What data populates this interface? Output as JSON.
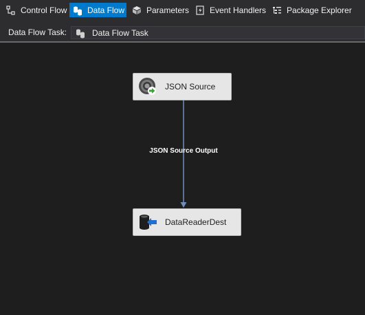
{
  "tabs": [
    {
      "label": "Control Flow",
      "icon": "control-flow-icon",
      "active": false
    },
    {
      "label": "Data Flow",
      "icon": "data-flow-icon",
      "active": true
    },
    {
      "label": "Parameters",
      "icon": "parameters-icon",
      "active": false
    },
    {
      "label": "Event Handlers",
      "icon": "event-handlers-icon",
      "active": false
    },
    {
      "label": "Package Explorer",
      "icon": "package-explorer-icon",
      "active": false
    }
  ],
  "task_selector": {
    "label": "Data Flow Task:",
    "value": "Data Flow Task",
    "icon": "data-flow-task-icon"
  },
  "components": [
    {
      "label": "JSON Source",
      "icon": "json-source-icon"
    },
    {
      "label": "DataReaderDest",
      "icon": "datareader-destination-icon"
    }
  ],
  "path": {
    "label": "JSON Source Output"
  },
  "colors": {
    "background": "#1e1e1e",
    "toolbar": "#2d2d30",
    "active_tab": "#007acc",
    "component_fill": "#e6e6e6",
    "connector": "#6f8fb8"
  }
}
